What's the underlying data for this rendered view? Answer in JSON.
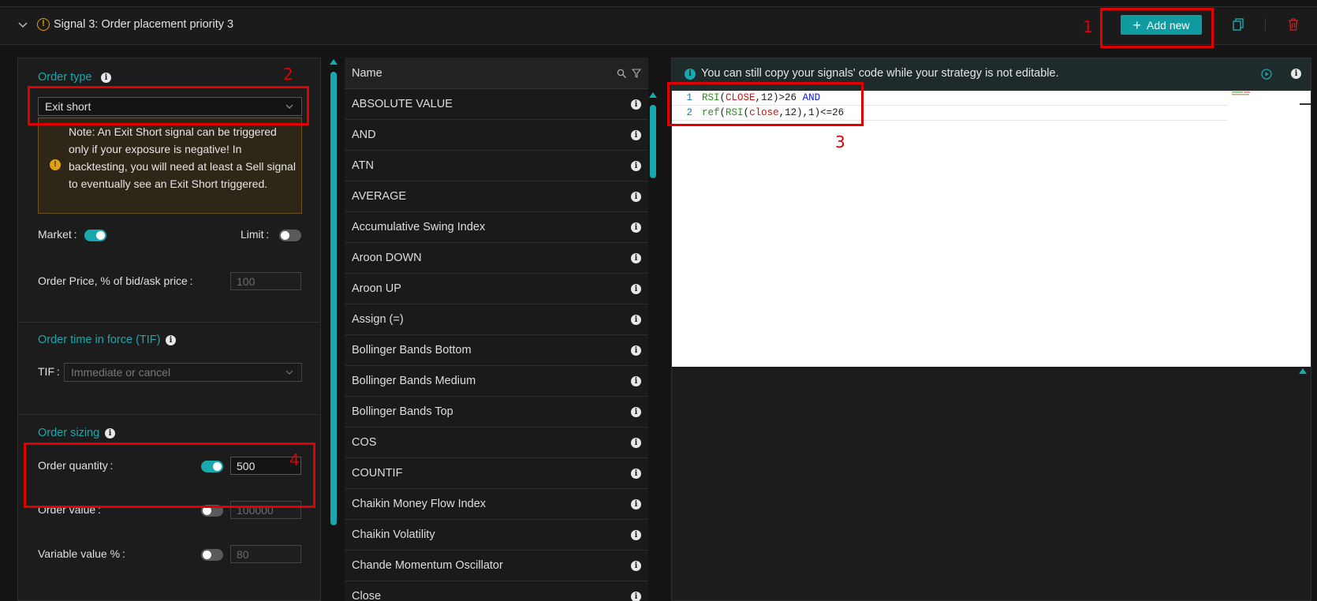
{
  "header": {
    "title": "Signal 3: Order placement priority 3",
    "add_new_label": "Add new"
  },
  "order_type": {
    "title": "Order type",
    "selected": "Exit short",
    "note": "Note: An Exit Short signal can be triggered only if your exposure is negative! In backtesting, you will need at least a Sell signal to eventually see an Exit Short triggered.",
    "market_label": "Market :",
    "market_on": true,
    "limit_label": "Limit :",
    "limit_on": false,
    "order_price_label": "Order Price, % of bid/ask price :",
    "order_price_value": "100"
  },
  "tif": {
    "title": "Order time in force (TIF)",
    "label": "TIF :",
    "selected": "Immediate or cancel"
  },
  "order_sizing": {
    "title": "Order sizing",
    "quantity_label": "Order quantity :",
    "quantity_on": true,
    "quantity_value": "500",
    "value_label": "Order value :",
    "value_on": false,
    "value_value": "100000",
    "variable_label": "Variable value % :",
    "variable_on": false,
    "variable_value": "80"
  },
  "functions": {
    "header": "Name",
    "items": [
      "ABSOLUTE VALUE",
      "AND",
      "ATN",
      "AVERAGE",
      "Accumulative Swing Index",
      "Aroon DOWN",
      "Aroon UP",
      "Assign (=)",
      "Bollinger Bands Bottom",
      "Bollinger Bands Medium",
      "Bollinger Bands Top",
      "COS",
      "COUNTIF",
      "Chaikin Money Flow Index",
      "Chaikin Volatility",
      "Chande Momentum Oscillator",
      "Close"
    ]
  },
  "code": {
    "info": "You can still copy your signals' code while your strategy is not editable.",
    "line_numbers": [
      "1",
      "2"
    ],
    "line1": {
      "fn": "RSI",
      "p1": "(",
      "var": "CLOSE",
      "p2": ",12)>26 ",
      "kw": "AND"
    },
    "line2": {
      "fn1": "ref",
      "p1": "(",
      "fn2": "RSI",
      "p2": "(",
      "var": "close",
      "p3": ",12),1)<=26"
    }
  },
  "annotations": [
    "1",
    "2",
    "3",
    "4"
  ],
  "colors": {
    "accent": "#17a9ad",
    "warning": "#e0a010",
    "annotation": "#e00000",
    "delete": "#d02020"
  },
  "icons": [
    "chevron-down-icon",
    "warning-icon",
    "plus-icon",
    "copy-icon",
    "trash-icon",
    "info-icon",
    "search-icon",
    "filter-icon",
    "run-icon"
  ]
}
